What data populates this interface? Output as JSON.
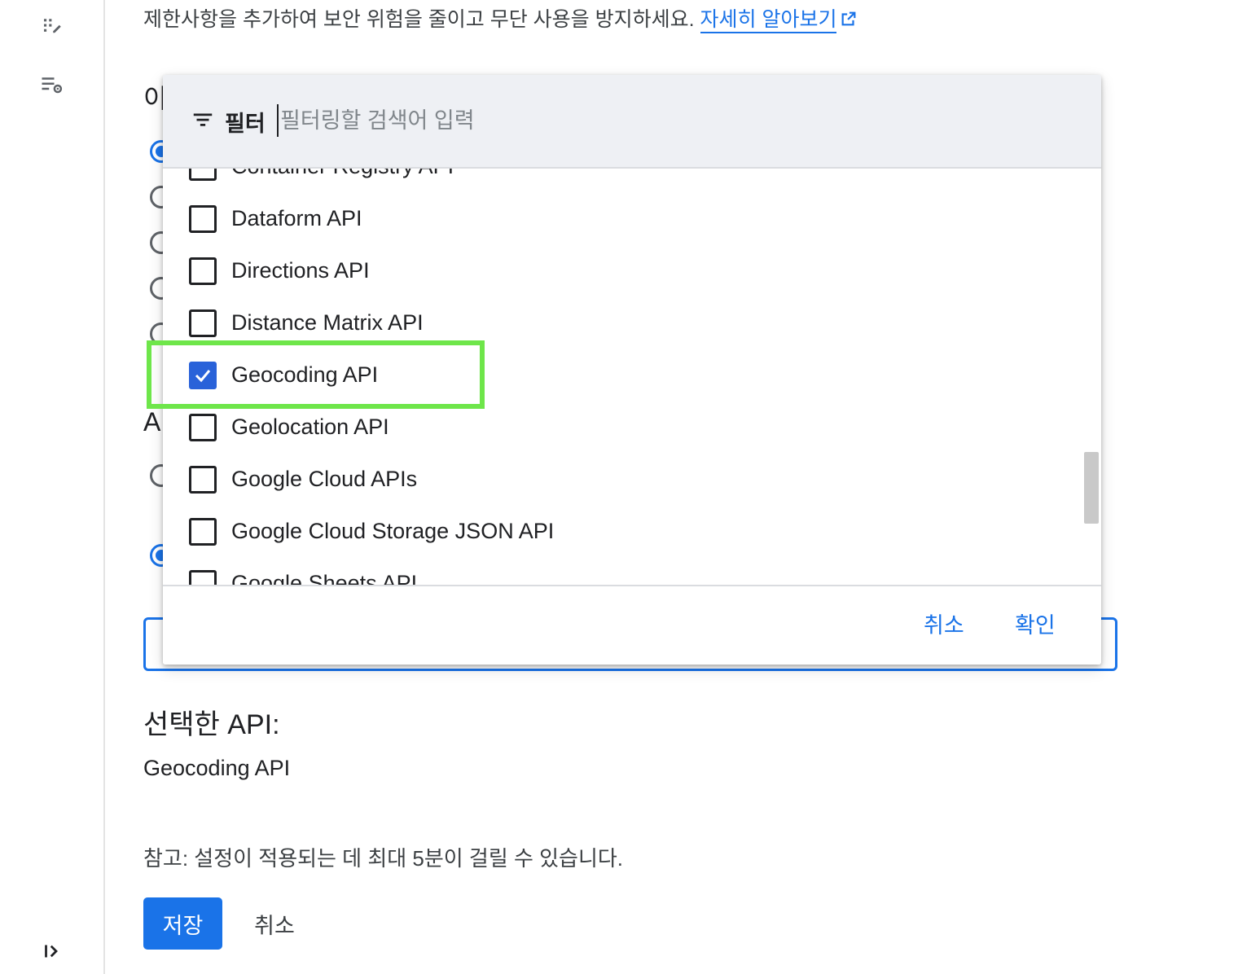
{
  "sidebar": {
    "icons": [
      "api-explorer-icon",
      "settings-list-icon",
      "expand-sidebar-icon"
    ]
  },
  "intro": {
    "text": "제한사항을 추가하여 보안 위험을 줄이고 무단 사용을 방지하세요. ",
    "link": "자세히 알아보기"
  },
  "background": {
    "heading_1": "이",
    "heading_2": "A"
  },
  "filter": {
    "label": "필터",
    "placeholder": "필터링할 검색어 입력"
  },
  "api_list": {
    "items": [
      {
        "label": "Container Registry API",
        "checked": false
      },
      {
        "label": "Dataform API",
        "checked": false
      },
      {
        "label": "Directions API",
        "checked": false
      },
      {
        "label": "Distance Matrix API",
        "checked": false
      },
      {
        "label": "Geocoding API",
        "checked": true
      },
      {
        "label": "Geolocation API",
        "checked": false
      },
      {
        "label": "Google Cloud APIs",
        "checked": false
      },
      {
        "label": "Google Cloud Storage JSON API",
        "checked": false
      },
      {
        "label": "Google Sheets API",
        "checked": false
      }
    ]
  },
  "dialog": {
    "cancel_label": "취소",
    "ok_label": "확인"
  },
  "selected": {
    "title": "선택한 API:",
    "value": "Geocoding API"
  },
  "note": "참고: 설정이 적용되는 데 최대 5분이 걸릴 수 있습니다.",
  "actions": {
    "save_label": "저장",
    "cancel_label": "취소"
  },
  "colors": {
    "accent": "#1a73e8",
    "checkbox_checked": "#2962d9",
    "highlight": "#6ee64a"
  }
}
